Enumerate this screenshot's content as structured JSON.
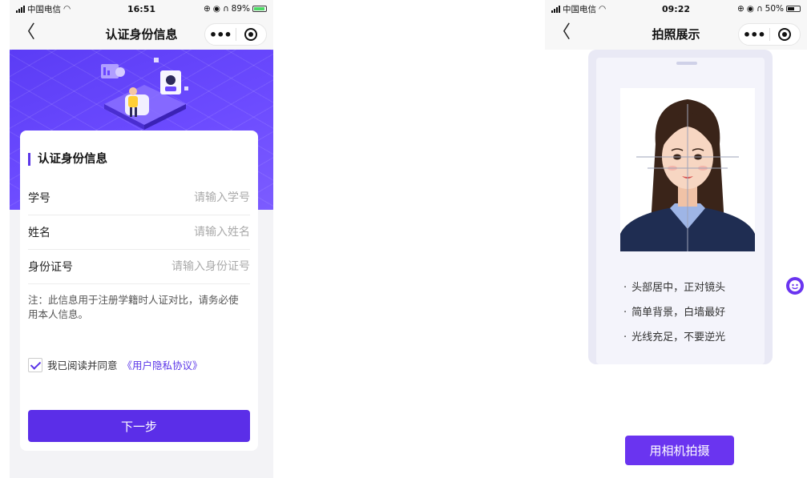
{
  "left_screen": {
    "status_bar": {
      "carrier": "中国电信",
      "time": "16:51",
      "battery": "89%"
    },
    "nav": {
      "back_icon": "chevron-left-icon",
      "title": "认证身份信息",
      "more_label": "•••",
      "close_icon": "target-icon"
    },
    "form": {
      "section_title": "认证身份信息",
      "fields": [
        {
          "label": "学号",
          "placeholder": "请输入学号",
          "value": ""
        },
        {
          "label": "姓名",
          "placeholder": "请输入姓名",
          "value": ""
        },
        {
          "label": "身份证号",
          "placeholder": "请输入身份证号",
          "value": ""
        }
      ],
      "note": "注：此信息用于注册学籍时人证对比，请务必使用本人信息。",
      "agree_text": "我已阅读并同意",
      "agree_link": "《用户隐私协议》",
      "agree_checked": true,
      "next_button": "下一步"
    }
  },
  "right_screen": {
    "status_bar": {
      "carrier": "中国电信",
      "time": "09:22",
      "battery": "50%"
    },
    "nav": {
      "back_icon": "chevron-left-icon",
      "title": "拍照展示",
      "more_label": "•••",
      "close_icon": "target-icon"
    },
    "tips": [
      "头部居中，正对镜头",
      "简单背景，白墙最好",
      "光线充足，不要逆光"
    ],
    "camera_button": "用相机拍摄",
    "service_icon": "customer-service-icon"
  },
  "colors": {
    "accent": "#5b2ee8",
    "hero": "#6a46ff",
    "camera_button": "#6a34f0"
  },
  "battery_levels": {
    "left": 0.89,
    "right": 0.5
  }
}
